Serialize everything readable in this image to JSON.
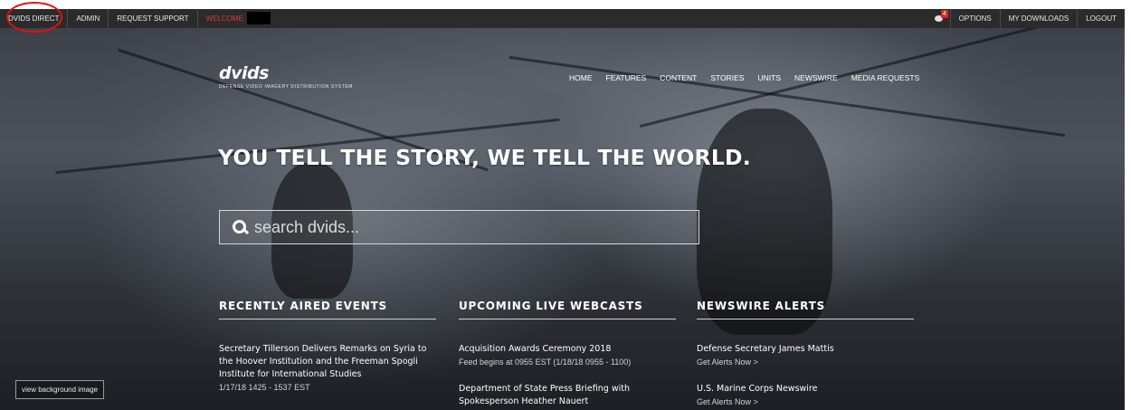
{
  "topbar": {
    "left_items": [
      "DVIDS DIRECT",
      "ADMIN",
      "REQUEST SUPPORT"
    ],
    "welcome": "WELCOME",
    "notification_count": "4",
    "right_items": [
      "OPTIONS",
      "MY DOWNLOADS",
      "LOGOUT"
    ]
  },
  "logo": {
    "name": "dvids",
    "tagline": "Defense Video Imagery Distribution System"
  },
  "nav": [
    "HOME",
    "FEATURES",
    "CONTENT",
    "STORIES",
    "UNITS",
    "NEWSWIRE",
    "MEDIA REQUESTS"
  ],
  "hero": "YOU TELL THE STORY, WE TELL THE WORLD.",
  "search": {
    "placeholder": "search dvids..."
  },
  "columns": {
    "recent": {
      "title": "RECENTLY AIRED EVENTS",
      "items": [
        {
          "title": "Secretary Tillerson Delivers Remarks on Syria to the Hoover Institution and the Freeman Spogli Institute for International Studies",
          "meta": "1/17/18 1425 - 1537 EST"
        }
      ]
    },
    "upcoming": {
      "title": "UPCOMING LIVE WEBCASTS",
      "items": [
        {
          "title": "Acquisition Awards Ceremony 2018",
          "meta": "Feed begins at 0955 EST  (1/18/18 0955 - 1100)"
        },
        {
          "title": "Department of State Press Briefing with Spokesperson Heather Nauert",
          "meta": ""
        }
      ]
    },
    "newswire": {
      "title": "NEWSWIRE ALERTS",
      "items": [
        {
          "title": "Defense Secretary James Mattis",
          "link": "Get Alerts Now  >"
        },
        {
          "title": "U.S. Marine Corps Newswire",
          "link": "Get Alerts Now  >"
        }
      ]
    }
  },
  "view_background": "view background image"
}
